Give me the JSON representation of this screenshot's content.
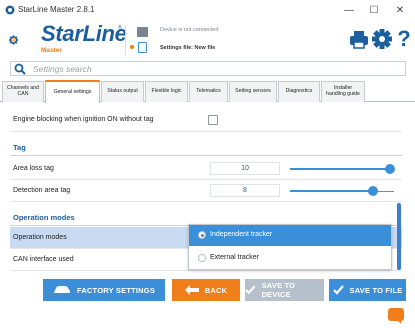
{
  "window": {
    "title": "StarLine Master 2.8.1",
    "minimize": "—",
    "maximize": "☐",
    "close": "✕"
  },
  "header": {
    "logo_text": "StarLine",
    "logo_reg": "®",
    "logo_sub": "Master",
    "device_status": "Device is not connected",
    "settings_file": "Settings file: New file",
    "help": "?"
  },
  "search": {
    "placeholder": "Settings search"
  },
  "tabs": [
    {
      "label": "Channels and CAN"
    },
    {
      "label": "General settings",
      "active": true
    },
    {
      "label": "Status output"
    },
    {
      "label": "Flexible logic"
    },
    {
      "label": "Telematics"
    },
    {
      "label": "Setting sensors"
    },
    {
      "label": "Diagnostics"
    },
    {
      "label": "Installer handling guide"
    }
  ],
  "content": {
    "engine_blocking_label": "Engine blocking when ignition ON without tag",
    "tag_section": "Tag",
    "area_loss_label": "Area loss tag",
    "area_loss_value": "10",
    "area_loss_level": 0.96,
    "detection_area_label": "Detection area tag",
    "detection_area_value": "8",
    "detection_area_level": 0.8,
    "operation_modes_section": "Operation modes",
    "operation_modes_label": "Operation modes",
    "can_interface_label": "CAN interface used"
  },
  "dropdown": {
    "options": [
      {
        "label": "Independent tracker",
        "selected": true
      },
      {
        "label": "External tracker",
        "selected": false
      }
    ]
  },
  "buttons": {
    "factory": "FACTORY SETTINGS",
    "back": "BACK",
    "save_device": "SAVE TO DEVICE",
    "save_file": "SAVE TO FILE"
  },
  "colors": {
    "brand_blue": "#1c5f9e",
    "accent_blue": "#3b8fd9",
    "accent_orange": "#f07e1b",
    "disabled_gray": "#b6c0cc",
    "selected_row": "#c8dbf2"
  }
}
